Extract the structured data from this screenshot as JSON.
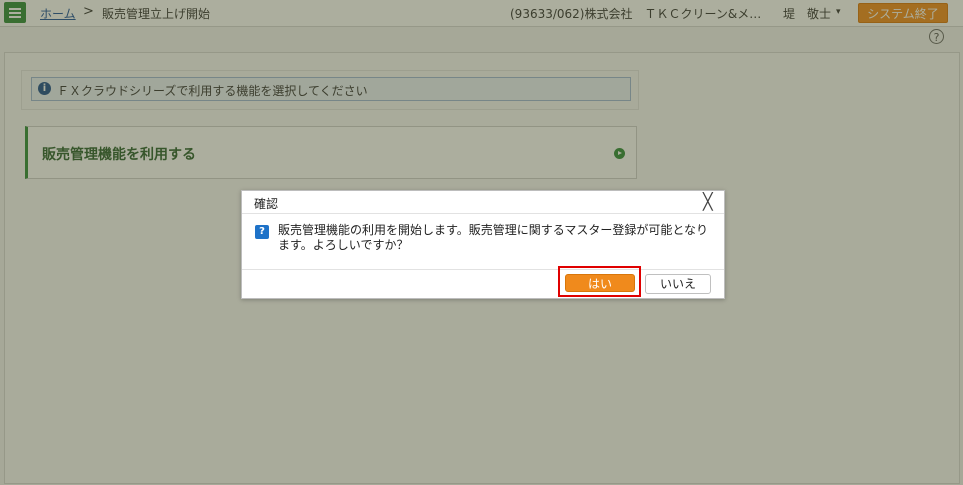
{
  "header": {
    "breadcrumb_home": "ホーム",
    "breadcrumb_sep": ">",
    "breadcrumb_current": "販売管理立上げ開始",
    "company": "(93633/062)株式会社　ＴＫＣクリーン&メ…",
    "user": "堤　敬士",
    "user_caret": "▾",
    "system_exit": "システム終了",
    "help": "?"
  },
  "main": {
    "info_icon": "i",
    "info_text": "ＦＸクラウドシリーズで利用する機能を選択してください",
    "feature_label": "販売管理機能を利用する"
  },
  "dialog": {
    "title": "確認",
    "close": "╳",
    "question_icon": "?",
    "message": "販売管理機能の利用を開始します。販売管理に関するマスター登録が可能となります。よろしいですか？",
    "yes": "はい",
    "no": "いいえ"
  },
  "colors": {
    "accent_green": "#2f8a3a",
    "orange": "#f08a1c",
    "highlight_red": "#e00000"
  }
}
